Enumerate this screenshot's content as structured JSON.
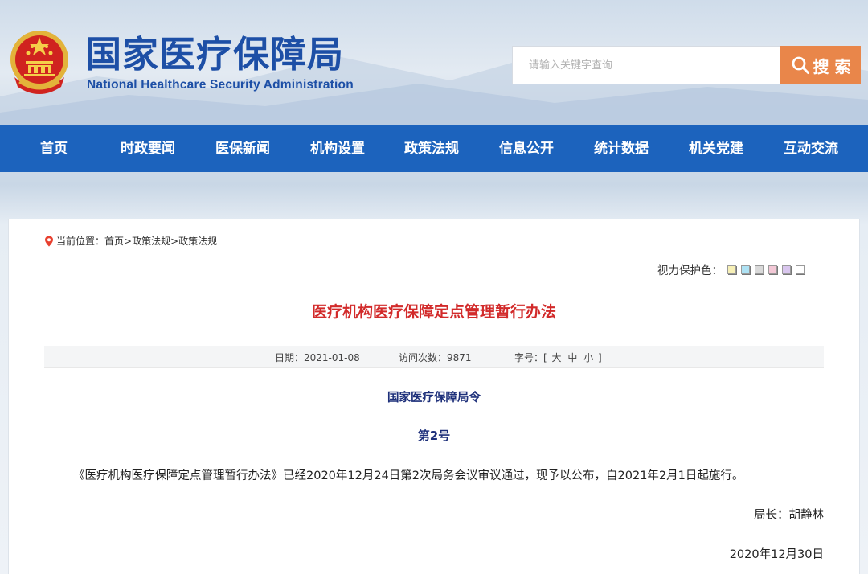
{
  "header": {
    "title": "国家医疗保障局",
    "subtitle": "National Healthcare Security Administration",
    "search_placeholder": "请输入关键字查询",
    "search_label": "搜 索"
  },
  "nav": {
    "items": [
      {
        "label": "首页"
      },
      {
        "label": "时政要闻"
      },
      {
        "label": "医保新闻"
      },
      {
        "label": "机构设置"
      },
      {
        "label": "政策法规"
      },
      {
        "label": "信息公开"
      },
      {
        "label": "统计数据"
      },
      {
        "label": "机关党建"
      },
      {
        "label": "互动交流"
      }
    ]
  },
  "breadcrumb": {
    "prefix": "当前位置：",
    "items": [
      "首页",
      ">",
      "政策法规",
      ">",
      "政策法规"
    ]
  },
  "eye_care": {
    "label": "视力保护色：",
    "swatches": [
      "#f7f0b6",
      "#aee2f4",
      "#d9d9d9",
      "#f3c8d6",
      "#d9c6ee",
      "#ffffff"
    ]
  },
  "article": {
    "title": "医疗机构医疗保障定点管理暂行办法",
    "date_label": "日期：",
    "date": "2021-01-08",
    "visits_label": "访问次数：",
    "visits": "9871",
    "font_size_label": "字号：[",
    "font_size_options": [
      "大",
      "中",
      "小"
    ],
    "font_size_end": "]",
    "issuer": "国家医疗保障局令",
    "number": "第2号",
    "body": "《医疗机构医疗保障定点管理暂行办法》已经2020年12月24日第2次局务会议审议通过，现予以公布，自2021年2月1日起施行。",
    "signer": "局长：胡静林",
    "sign_date": "2020年12月30日"
  },
  "colors": {
    "brand_blue": "#1c63bd",
    "title_red": "#d22a2a",
    "search_orange": "#e9864a",
    "decree_navy": "#1d2f7a"
  }
}
